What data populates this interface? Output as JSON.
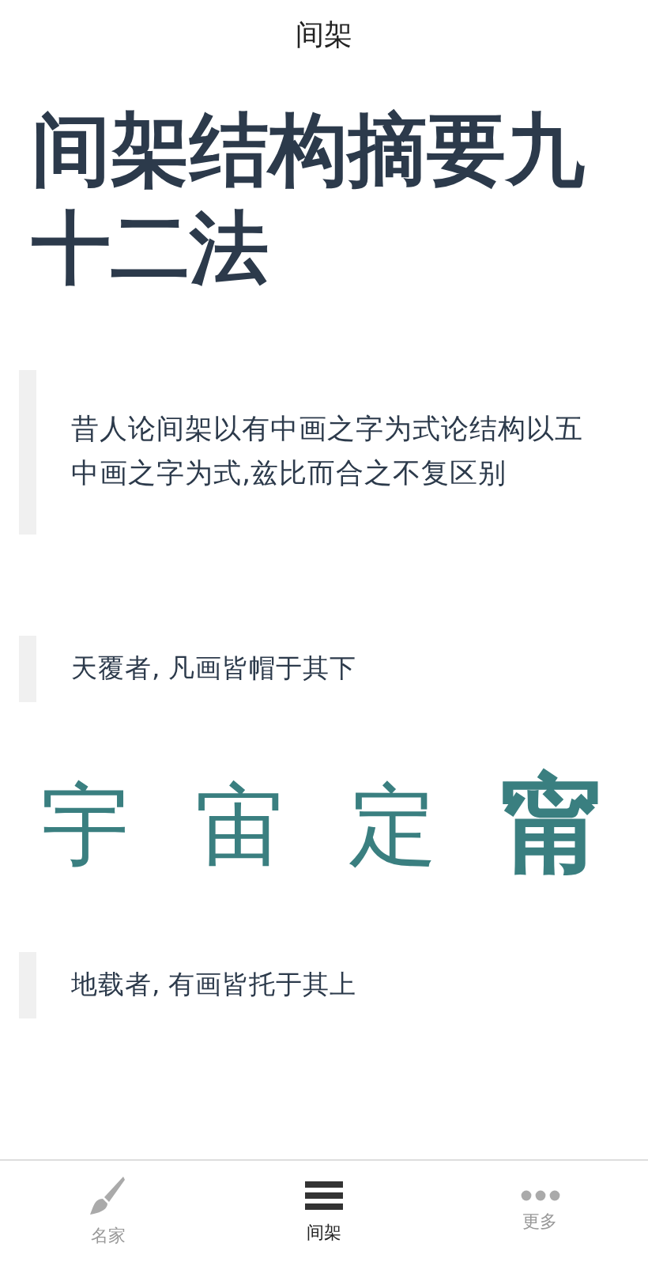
{
  "header": {
    "title": "间架"
  },
  "page_title": "间架结构摘要九十二法",
  "quote": "昔人论间架以有中画之字为式论结构以五中画之字为式,兹比而合之不复区别",
  "sections": [
    {
      "heading": "天覆者, 凡画皆帽于其下",
      "examples": [
        {
          "char": "宇",
          "kind": "brush"
        },
        {
          "char": "宙",
          "kind": "brush"
        },
        {
          "char": "定",
          "kind": "brush"
        },
        {
          "char": "甯",
          "kind": "print"
        }
      ]
    },
    {
      "heading": "地载者, 有画皆托于其上"
    }
  ],
  "tabs": [
    {
      "label": "名家",
      "selected": false
    },
    {
      "label": "间架",
      "selected": true
    },
    {
      "label": "更多",
      "selected": false
    }
  ]
}
